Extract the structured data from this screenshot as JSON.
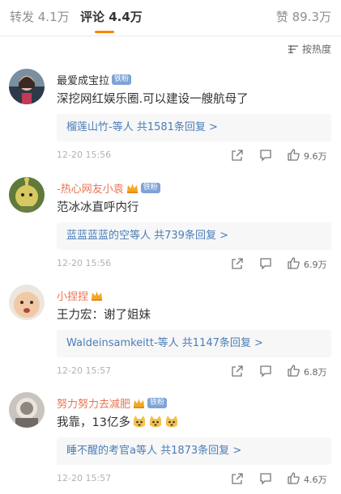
{
  "tabs": {
    "repost": "转发 4.1万",
    "comment": "评论 4.4万",
    "like": "赞 89.3万"
  },
  "sort": {
    "label": "按热度",
    "icon": "sort-icon"
  },
  "colors": {
    "accent": "#ff8200",
    "username": "#eb7350",
    "link": "#4a7db8",
    "badge": "#7ea3d8"
  },
  "comments": [
    {
      "name": "最爱成宝拉",
      "badge": "铁粉",
      "text": "深挖网红娱乐圈.可以建设一艘航母了",
      "replies": "榴莲山竹-等人  共1581条回复 >",
      "time": "12-20 15:56",
      "likes": "9.6万"
    },
    {
      "name": "-热心网友小袁",
      "badge": "铁粉",
      "text": "范冰冰直呼内行",
      "replies": "蓝蓝蓝蓝的空等人  共739条回复 >",
      "time": "12-20 15:56",
      "likes": "6.9万"
    },
    {
      "name": "小捏捏",
      "badge": "",
      "text": "王力宏：谢了姐妹",
      "replies": "Waldeinsamkeitt-等人  共1147条回复 >",
      "time": "12-20 15:57",
      "likes": "6.8万"
    },
    {
      "name": "努力努力去减肥",
      "badge": "铁粉",
      "text": "我靠，13亿多",
      "replies": "睡不醒的考官a等人  共1873条回复 >",
      "time": "12-20 15:57",
      "likes": "4.6万"
    }
  ]
}
